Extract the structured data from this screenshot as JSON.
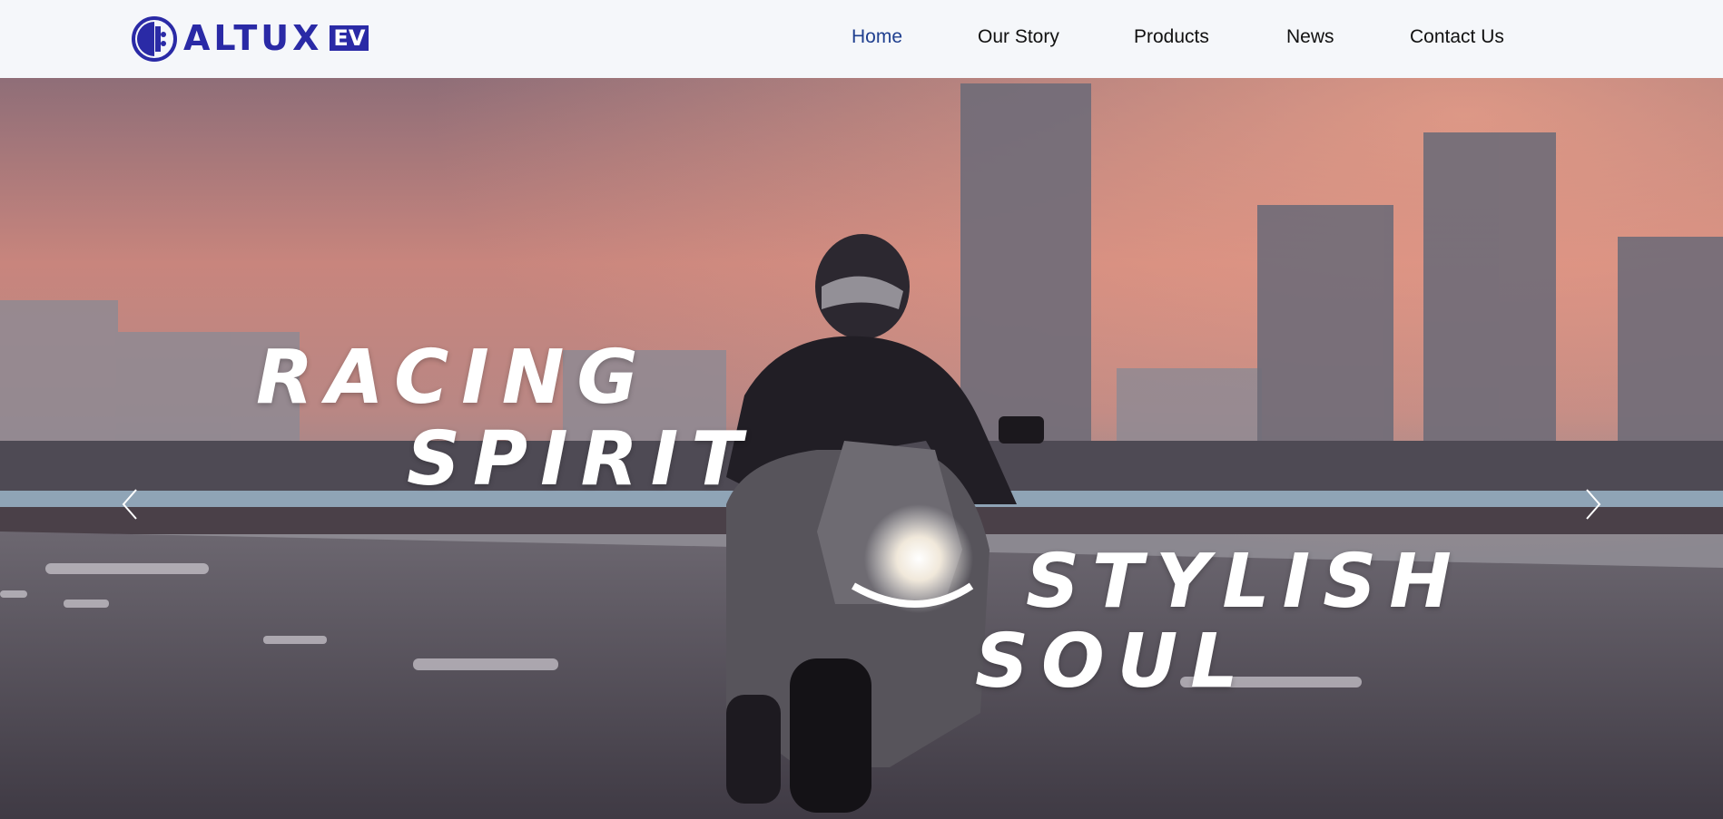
{
  "brand": {
    "name": "ALTUX",
    "badge": "EV",
    "tm": "™",
    "color": "#2a2aa6"
  },
  "nav": {
    "items": [
      {
        "label": "Home",
        "active": true
      },
      {
        "label": "Our Story"
      },
      {
        "label": "Products"
      },
      {
        "label": "News"
      },
      {
        "label": "Contact Us"
      }
    ],
    "active_color": "#1f3f8f"
  },
  "hero": {
    "line1": "RACING",
    "line2": "SPIRIT",
    "line3": "STYLISH",
    "line4": "SOUL",
    "prev_icon": "chevron-left-icon",
    "next_icon": "chevron-right-icon"
  }
}
